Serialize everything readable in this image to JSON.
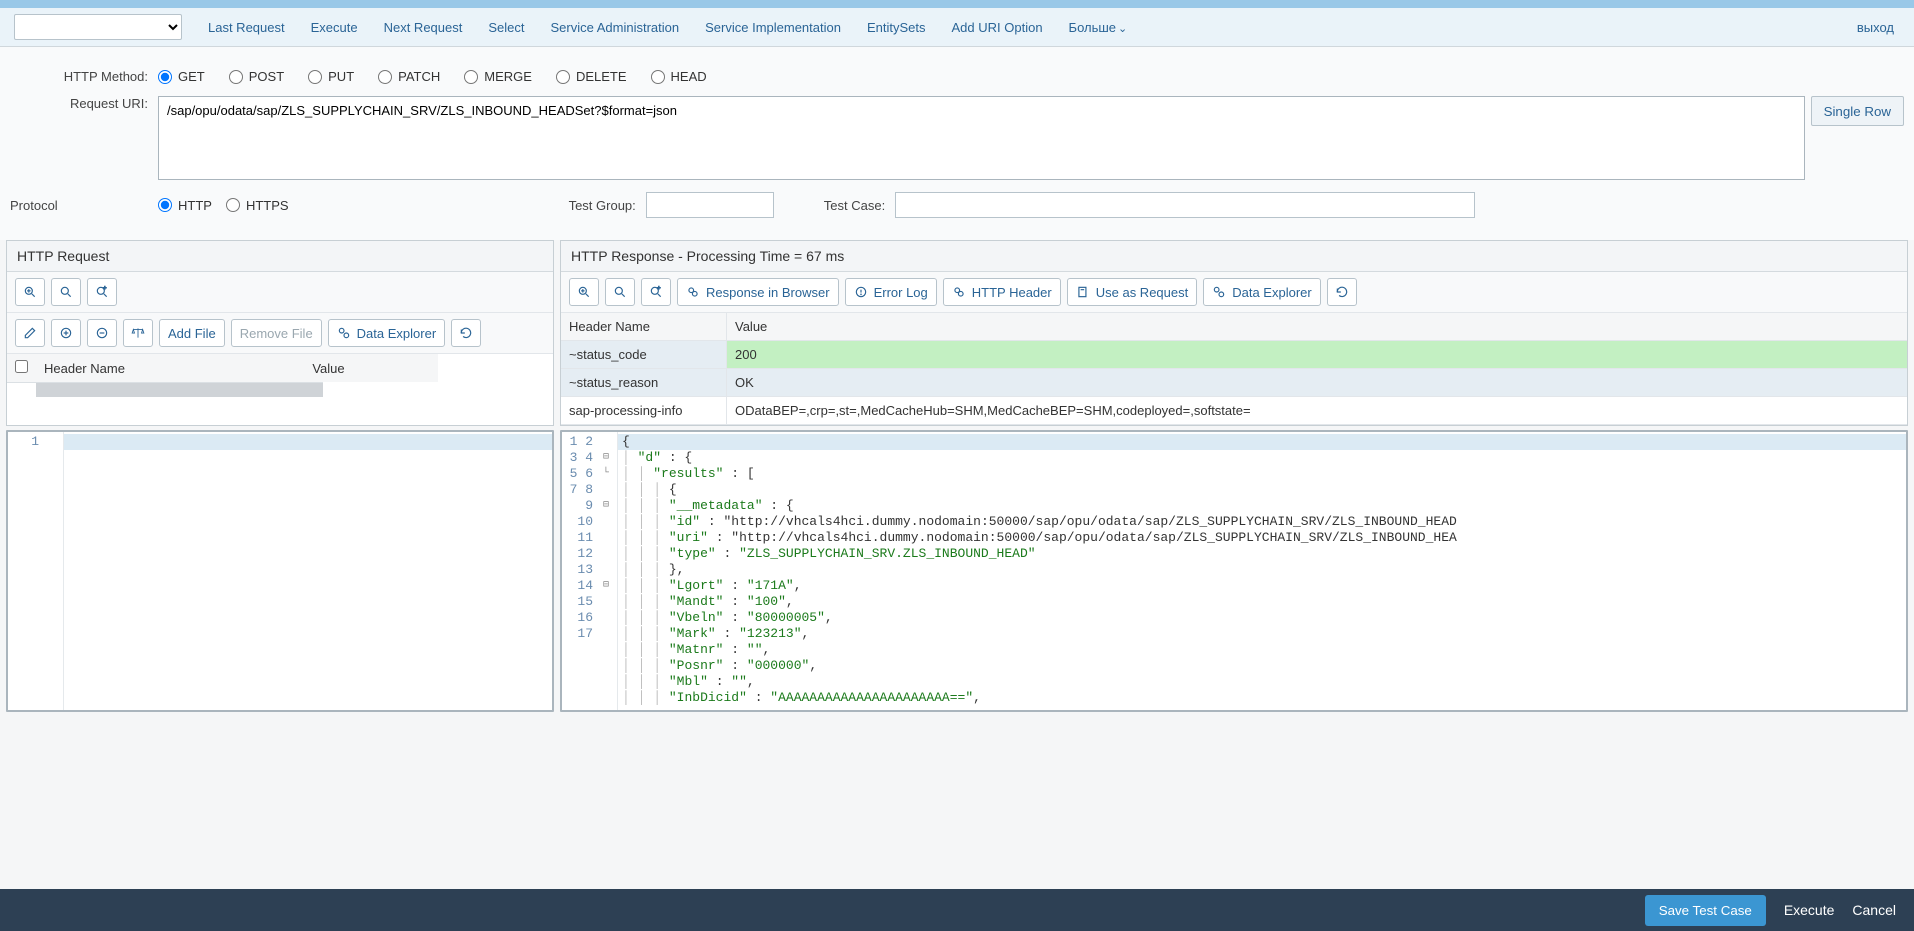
{
  "menu": {
    "items": [
      "Last Request",
      "Execute",
      "Next Request",
      "Select",
      "Service Administration",
      "Service Implementation",
      "EntitySets",
      "Add URI Option"
    ],
    "more": "Больше",
    "exit": "выход"
  },
  "form": {
    "http_method_label": "HTTP Method:",
    "methods": [
      "GET",
      "POST",
      "PUT",
      "PATCH",
      "MERGE",
      "DELETE",
      "HEAD"
    ],
    "selected_method": "GET",
    "uri_label": "Request URI:",
    "uri_value": "/sap/opu/odata/sap/ZLS_SUPPLYCHAIN_SRV/ZLS_INBOUND_HEADSet?$format=json",
    "single_row": "Single Row",
    "protocol_label": "Protocol",
    "protocols": [
      "HTTP",
      "HTTPS"
    ],
    "selected_protocol": "HTTP",
    "test_group_label": "Test Group:",
    "test_group_value": "",
    "test_case_label": "Test Case:",
    "test_case_value": ""
  },
  "panels": {
    "request_title": "HTTP Request",
    "response_title": "HTTP Response - Processing Time = 67  ms",
    "req_toolbar": {
      "add_file": "Add File",
      "remove_file": "Remove File",
      "data_explorer": "Data Explorer"
    },
    "resp_toolbar": {
      "resp_browser": "Response in Browser",
      "error_log": "Error Log",
      "http_header": "HTTP Header",
      "use_as_request": "Use as Request",
      "data_explorer": "Data Explorer"
    },
    "req_headers": {
      "col_name": "Header Name",
      "col_value": "Value"
    },
    "resp_headers": {
      "col_name": "Header Name",
      "col_value": "Value",
      "rows": [
        {
          "name": "~status_code",
          "value": "200",
          "style": "green"
        },
        {
          "name": "~status_reason",
          "value": "OK",
          "style": "blue"
        },
        {
          "name": "sap-processing-info",
          "value": "ODataBEP=,crp=,st=,MedCacheHub=SHM,MedCacheBEP=SHM,codeployed=,softstate=",
          "style": "none"
        }
      ]
    }
  },
  "code": {
    "lines": [
      "{",
      "  \"d\" : {",
      "    \"results\" : [",
      "      {",
      "        \"__metadata\" : {",
      "          \"id\" : \"http://vhcals4hci.dummy.nodomain:50000/sap/opu/odata/sap/ZLS_SUPPLYCHAIN_SRV/ZLS_INBOUND_HEAD",
      "          \"uri\" : \"http://vhcals4hci.dummy.nodomain:50000/sap/opu/odata/sap/ZLS_SUPPLYCHAIN_SRV/ZLS_INBOUND_HEA",
      "          \"type\" : \"ZLS_SUPPLYCHAIN_SRV.ZLS_INBOUND_HEAD\"",
      "        },",
      "        \"Lgort\" : \"171A\",",
      "        \"Mandt\" : \"100\",",
      "        \"Vbeln\" : \"80000005\",",
      "        \"Mark\" : \"123213\",",
      "        \"Matnr\" : \"\",",
      "        \"Posnr\" : \"000000\",",
      "        \"Mbl\" : \"\",",
      "        \"InbDicid\" : \"AAAAAAAAAAAAAAAAAAAAAA==\","
    ]
  },
  "bottom": {
    "save": "Save Test Case",
    "execute": "Execute",
    "cancel": "Cancel"
  }
}
